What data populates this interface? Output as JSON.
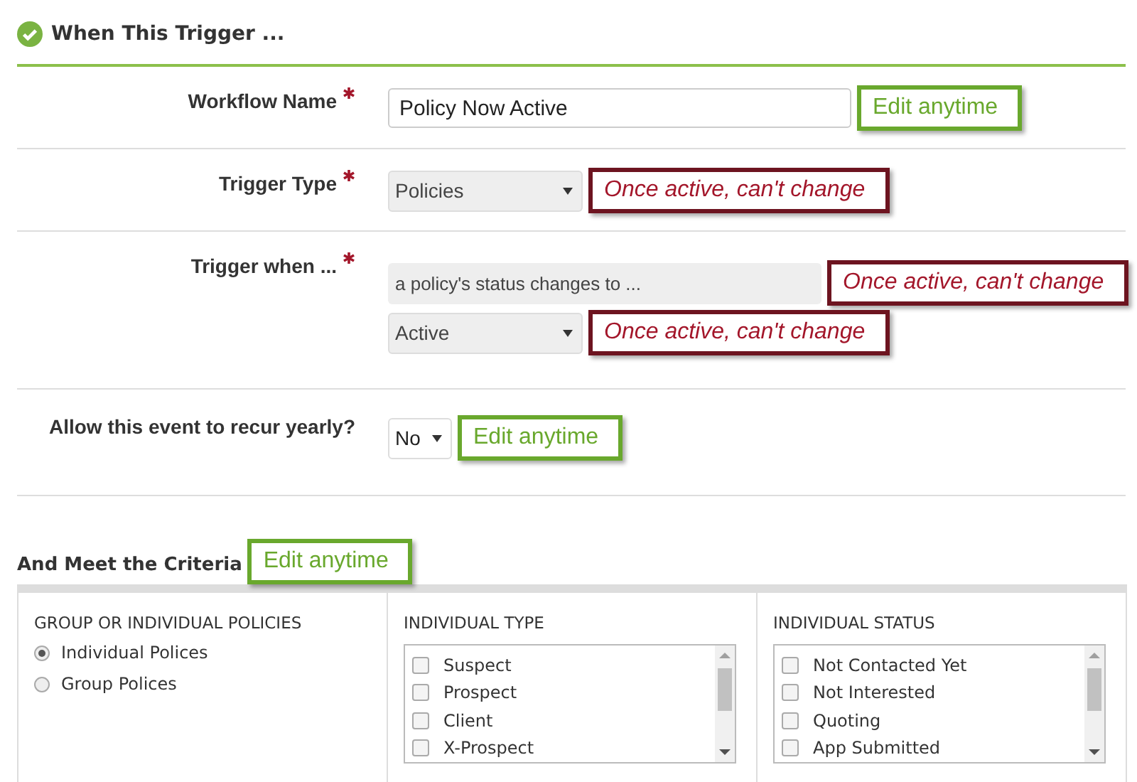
{
  "header": {
    "title": "When This Trigger ...",
    "complete": true
  },
  "fields": [
    {
      "label": "Workflow Name",
      "required": true,
      "controls": [
        {
          "kind": "text",
          "value": "Policy Now Active",
          "callout": {
            "text": "Edit anytime",
            "kind": "editable"
          }
        }
      ]
    },
    {
      "label": "Trigger Type",
      "required": true,
      "controls": [
        {
          "kind": "select",
          "value": "Policies",
          "disabled": true,
          "callout": {
            "text": "Once active, can't change",
            "kind": "locked"
          }
        }
      ]
    },
    {
      "label": "Trigger when ...",
      "required": true,
      "controls": [
        {
          "kind": "readonly",
          "value": "a policy's status changes to ...",
          "callout": {
            "text": "Once active, can't change",
            "kind": "locked"
          }
        },
        {
          "kind": "select",
          "value": "Active",
          "disabled": true,
          "callout": {
            "text": "Once active, can't change",
            "kind": "locked"
          }
        }
      ]
    },
    {
      "label": "Allow this event to recur yearly?",
      "required": false,
      "controls": [
        {
          "kind": "select",
          "value": "No",
          "disabled": false,
          "callout": {
            "text": "Edit anytime",
            "kind": "editable"
          }
        }
      ]
    }
  ],
  "criteria": {
    "title": "And Meet the Criteria",
    "callout": {
      "text": "Edit anytime",
      "kind": "editable"
    },
    "columns": [
      {
        "heading": "GROUP OR INDIVIDUAL POLICIES",
        "kind": "radio",
        "options": [
          {
            "label": "Individual Polices",
            "selected": true
          },
          {
            "label": "Group Polices",
            "selected": false
          }
        ]
      },
      {
        "heading": "INDIVIDUAL TYPE",
        "kind": "checklist",
        "options": [
          {
            "label": "Suspect",
            "checked": false
          },
          {
            "label": "Prospect",
            "checked": false
          },
          {
            "label": "Client",
            "checked": false
          },
          {
            "label": "X-Prospect",
            "checked": false
          }
        ]
      },
      {
        "heading": "INDIVIDUAL STATUS",
        "kind": "checklist",
        "options": [
          {
            "label": "Not Contacted Yet",
            "checked": false
          },
          {
            "label": "Not Interested",
            "checked": false
          },
          {
            "label": "Quoting",
            "checked": false
          },
          {
            "label": "App Submitted",
            "checked": false
          }
        ]
      }
    ]
  }
}
